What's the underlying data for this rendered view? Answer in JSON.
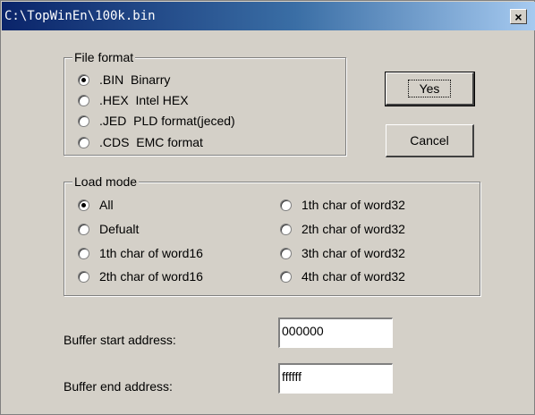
{
  "window": {
    "title": "C:\\TopWinEn\\100k.bin",
    "close_glyph": "×"
  },
  "file_format": {
    "legend": "File format",
    "options": [
      {
        "label": ".BIN  Binarry",
        "checked": true
      },
      {
        "label": ".HEX  Intel HEX",
        "checked": false
      },
      {
        "label": ".JED  PLD format(jeced)",
        "checked": false
      },
      {
        "label": ".CDS  EMC format",
        "checked": false
      }
    ]
  },
  "buttons": {
    "yes": "Yes",
    "cancel": "Cancel"
  },
  "load_mode": {
    "legend": "Load mode",
    "options": [
      {
        "label": "All",
        "checked": true
      },
      {
        "label": "Defualt",
        "checked": false
      },
      {
        "label": "1th char of word16",
        "checked": false
      },
      {
        "label": "2th char of word16",
        "checked": false
      },
      {
        "label": "1th char of word32",
        "checked": false
      },
      {
        "label": "2th char of word32",
        "checked": false
      },
      {
        "label": "3th char of word32",
        "checked": false
      },
      {
        "label": "4th char of word32",
        "checked": false
      }
    ]
  },
  "buffer": {
    "start_label": "Buffer start address:",
    "start_value": "000000",
    "end_label": "Buffer end address:",
    "end_value": "ffffff"
  }
}
